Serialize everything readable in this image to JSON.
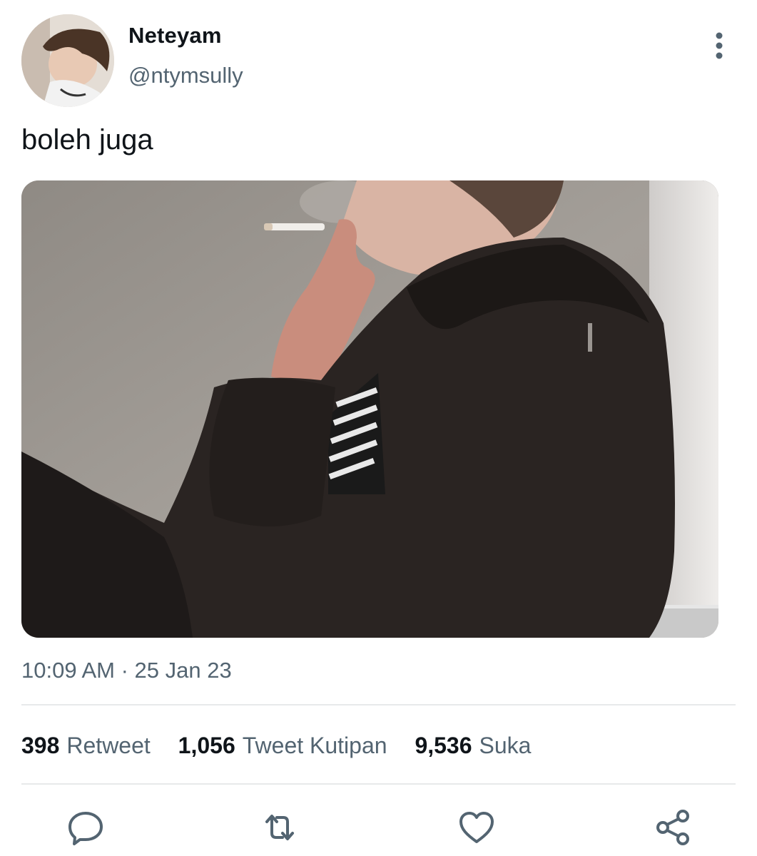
{
  "tweet": {
    "author": {
      "display_name": "Neteyam",
      "handle": "@ntymsully",
      "avatar_icon": "profile-photo"
    },
    "text": "boleh juga",
    "timestamp": "10:09 AM · 25 Jan 23",
    "stats": {
      "retweets": {
        "count": "398",
        "label": "Retweet"
      },
      "quotes": {
        "count": "1,056",
        "label": "Tweet Kutipan"
      },
      "likes": {
        "count": "9,536",
        "label": "Suka"
      }
    },
    "actions": [
      "reply-icon",
      "retweet-icon",
      "like-icon",
      "share-icon"
    ],
    "colors": {
      "text_primary": "#0f1419",
      "text_secondary": "#536471",
      "divider": "#e7e9ea",
      "icon": "#536471"
    }
  }
}
